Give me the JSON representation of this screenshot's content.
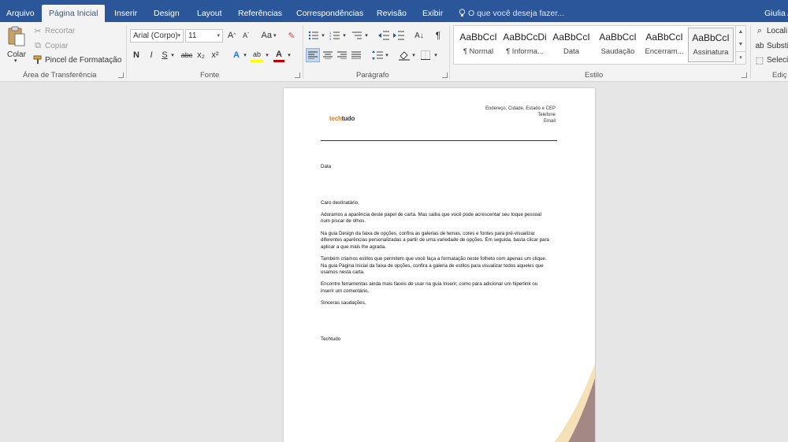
{
  "tabs": [
    {
      "label": "Arquivo",
      "active": false
    },
    {
      "label": "Página Inicial",
      "active": true
    },
    {
      "label": "Inserir",
      "active": false
    },
    {
      "label": "Design",
      "active": false
    },
    {
      "label": "Layout",
      "active": false
    },
    {
      "label": "Referências",
      "active": false
    },
    {
      "label": "Correspondências",
      "active": false
    },
    {
      "label": "Revisão",
      "active": false
    },
    {
      "label": "Exibir",
      "active": false
    }
  ],
  "tell_me": "O que você deseja fazer...",
  "user_name": "Giulia A",
  "clipboard": {
    "paste_label": "Colar",
    "cut_label": "Recortar",
    "copy_label": "Copiar",
    "format_painter_label": "Pincel de Formatação",
    "group_label": "Área de Transferência"
  },
  "font": {
    "font_name": "Arial (Corpo)",
    "font_size": "11",
    "grow_label": "A",
    "shrink_label": "A",
    "case_label": "Aa",
    "bold": "N",
    "italic": "I",
    "underline": "S",
    "strike": "abc",
    "subscript": "x₂",
    "superscript": "x²",
    "effects": "A",
    "highlight": "ab",
    "font_color": "A",
    "group_label": "Fonte"
  },
  "paragraph": {
    "group_label": "Parágrafo",
    "show_marks": "¶"
  },
  "styles": {
    "group_label": "Estilo",
    "items": [
      {
        "sample": "AaBbCcI",
        "name": "¶ Normal",
        "selected": false
      },
      {
        "sample": "AaBbCcDi",
        "name": "¶ Informa...",
        "selected": false
      },
      {
        "sample": "AaBbCcI",
        "name": "Data",
        "selected": false
      },
      {
        "sample": "AaBbCcI",
        "name": "Saudação",
        "selected": false
      },
      {
        "sample": "AaBbCcI",
        "name": "Encerram...",
        "selected": false
      },
      {
        "sample": "AaBbCcI",
        "name": "Assinatura",
        "selected": true
      }
    ]
  },
  "editing": {
    "group_label": "Ediç",
    "find_label": "Locali",
    "replace_label": "Substi",
    "select_label": "Seleci"
  },
  "document": {
    "logo_part1": "tech",
    "logo_part2": "tudo",
    "address_lines": [
      "Endereço, Cidade, Estado e CEP",
      "Telefone",
      "Email"
    ],
    "paragraphs": [
      "Data",
      "",
      "",
      "Caro destinatário,",
      "Adoramos a aparência deste papel de carta. Mas saiba que você pode acrescentar seu toque pessoal num piscar de olhos.",
      "Na guia Design da faixa de opções, confira as galerias de temas, cores e fontes para pré-visualizar diferentes aparências personalizadas a partir de uma variedade de opções. Em seguida, basta clicar para aplicar a que mais lhe agrada.",
      "Também criamos estilos que permitem que você faça a formatação neste folheto com apenas um clique. Na guia Página Inicial da faixa de opções, confira a galeria de estilos para visualizar todos aqueles que usamos nesta carta.",
      "Encontre ferramentas ainda mais fáceis de usar na guia Inserir, como para adicionar um hiperlink ou inserir um comentário.",
      "Sinceras saudações,",
      "",
      "",
      "Techtudo"
    ],
    "accent_colors": {
      "peach": "#f4e1b8",
      "mauve": "#a38986"
    }
  },
  "colors": {
    "tabbar_bg": "#2b579a",
    "ribbon_bg": "#f3f3f3",
    "canvas_bg": "#e6e6e6",
    "logo_orange": "#e07b1b",
    "highlight_yellow": "#ffff00",
    "font_color_red": "#c00000"
  }
}
